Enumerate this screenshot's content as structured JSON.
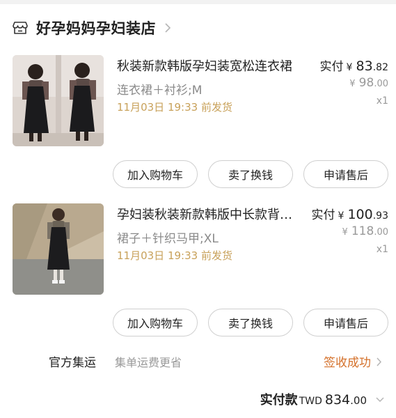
{
  "shop": {
    "name": "好孕妈妈孕妇装店",
    "icon": "shop-icon"
  },
  "products": [
    {
      "title": "秋装新款韩版孕妇装宽松连衣裙",
      "variant": "连衣裙＋衬衫;M",
      "shipping_note": "11月03日 19:33 前发货",
      "pay_label": "实付",
      "currency_symbol": "¥",
      "paid_int": "83",
      "paid_dec": ".82",
      "original_int": "98",
      "original_dec": ".00",
      "quantity": "x1",
      "buttons": [
        "加入购物车",
        "卖了换钱",
        "申请售后"
      ]
    },
    {
      "title": "孕妇装秋装新款韩版中长款背带裙",
      "variant": "裙子＋针织马甲;XL",
      "shipping_note": "11月03日 19:33 前发货",
      "pay_label": "实付",
      "currency_symbol": "¥",
      "paid_int": "100",
      "paid_dec": ".93",
      "original_int": "118",
      "original_dec": ".00",
      "quantity": "x1",
      "buttons": [
        "加入购物车",
        "卖了换钱",
        "申请售后"
      ]
    }
  ],
  "footer": {
    "shipping_method": "官方集运",
    "shipping_desc": "集单运费更省",
    "order_status": "签收成功"
  },
  "total": {
    "label": "实付款",
    "currency": "TWD",
    "amount_int": "834",
    "amount_dec": ".00"
  },
  "colors": {
    "shipping_note": "#c8a15a",
    "order_status": "#d4702a",
    "muted": "#999999"
  }
}
